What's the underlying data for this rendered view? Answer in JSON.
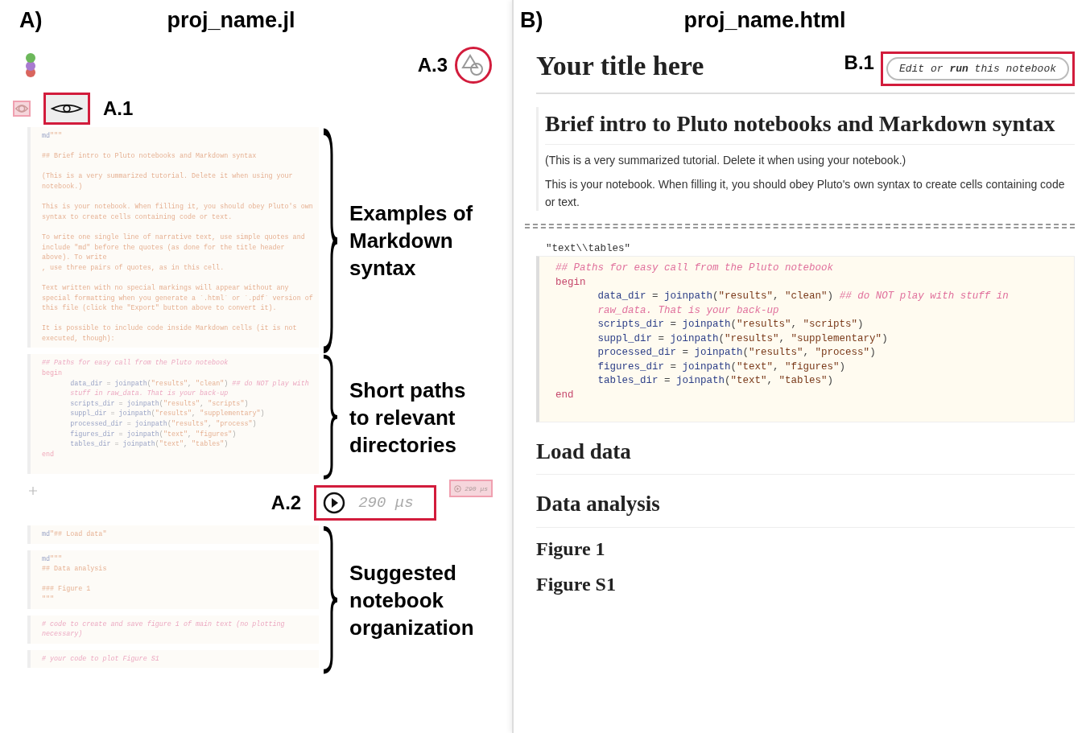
{
  "panel_a": {
    "letter": "A)",
    "file_title": "proj_name.jl",
    "a3_label": "A.3",
    "a1_label": "A.1",
    "a2_label": "A.2",
    "a2_timing": "290 μs",
    "cell_timing": "290 μs",
    "groups": [
      {
        "annotation": "Examples of Markdown syntax",
        "cells": [
          {
            "lines": [
              {
                "kind": "code",
                "segments": [
                  {
                    "kind": "macro",
                    "text": "md"
                  },
                  {
                    "kind": "string",
                    "text": "\"\"\""
                  }
                ]
              },
              {
                "kind": "blank"
              },
              {
                "kind": "code",
                "segments": [
                  {
                    "kind": "string",
                    "text": "## Brief intro to Pluto notebooks and Markdown syntax"
                  }
                ]
              },
              {
                "kind": "blank"
              },
              {
                "kind": "code",
                "segments": [
                  {
                    "kind": "string",
                    "text": "(This is a very summarized tutorial. Delete it when using your notebook.)"
                  }
                ]
              },
              {
                "kind": "blank"
              },
              {
                "kind": "code",
                "segments": [
                  {
                    "kind": "string",
                    "text": "This is your notebook. When filling it, you should obey Pluto's own syntax to create cells containing code or text."
                  }
                ]
              },
              {
                "kind": "blank"
              },
              {
                "kind": "code",
                "segments": [
                  {
                    "kind": "string",
                    "text": "To write one single line of narrative text, use simple quotes and include \"md\" before the quotes (as done for the title header above). To write"
                  }
                ]
              },
              {
                "kind": "code",
                "segments": [
                  {
                    "kind": "string",
                    "text": ", use three pairs of quotes, as in this cell."
                  }
                ]
              },
              {
                "kind": "blank"
              },
              {
                "kind": "code",
                "segments": [
                  {
                    "kind": "string",
                    "text": "Text written with no special markings will appear without any special formatting when you generate a `.html` or `.pdf` version of this file (click the \"Export\" button above to convert it)."
                  }
                ]
              },
              {
                "kind": "blank"
              },
              {
                "kind": "code",
                "segments": [
                  {
                    "kind": "string",
                    "text": "It is possible to include code inside Markdown cells (it is not executed, though):"
                  }
                ]
              }
            ]
          }
        ]
      },
      {
        "annotation": "Short paths to relevant directories",
        "cells": [
          {
            "lines": [
              {
                "kind": "code",
                "segments": [
                  {
                    "kind": "comment",
                    "text": "## Paths for easy call from the Pluto notebook"
                  }
                ]
              },
              {
                "kind": "code",
                "segments": [
                  {
                    "kind": "keyword",
                    "text": "begin"
                  }
                ]
              },
              {
                "kind": "code",
                "indent": true,
                "segments": [
                  {
                    "kind": "var",
                    "text": "data_dir"
                  },
                  {
                    "kind": "plain",
                    "text": " = "
                  },
                  {
                    "kind": "var",
                    "text": "joinpath"
                  },
                  {
                    "kind": "plain",
                    "text": "("
                  },
                  {
                    "kind": "string",
                    "text": "\"results\""
                  },
                  {
                    "kind": "plain",
                    "text": ", "
                  },
                  {
                    "kind": "string",
                    "text": "\"clean\""
                  },
                  {
                    "kind": "plain",
                    "text": ") "
                  },
                  {
                    "kind": "comment",
                    "text": "## do NOT play with stuff in raw_data. That is your back-up"
                  }
                ]
              },
              {
                "kind": "code",
                "indent": true,
                "segments": [
                  {
                    "kind": "var",
                    "text": "scripts_dir"
                  },
                  {
                    "kind": "plain",
                    "text": " = "
                  },
                  {
                    "kind": "var",
                    "text": "joinpath"
                  },
                  {
                    "kind": "plain",
                    "text": "("
                  },
                  {
                    "kind": "string",
                    "text": "\"results\""
                  },
                  {
                    "kind": "plain",
                    "text": ", "
                  },
                  {
                    "kind": "string",
                    "text": "\"scripts\""
                  },
                  {
                    "kind": "plain",
                    "text": ")"
                  }
                ]
              },
              {
                "kind": "code",
                "indent": true,
                "segments": [
                  {
                    "kind": "var",
                    "text": "suppl_dir"
                  },
                  {
                    "kind": "plain",
                    "text": " = "
                  },
                  {
                    "kind": "var",
                    "text": "joinpath"
                  },
                  {
                    "kind": "plain",
                    "text": "("
                  },
                  {
                    "kind": "string",
                    "text": "\"results\""
                  },
                  {
                    "kind": "plain",
                    "text": ", "
                  },
                  {
                    "kind": "string",
                    "text": "\"supplementary\""
                  },
                  {
                    "kind": "plain",
                    "text": ")"
                  }
                ]
              },
              {
                "kind": "code",
                "indent": true,
                "segments": [
                  {
                    "kind": "var",
                    "text": "processed_dir"
                  },
                  {
                    "kind": "plain",
                    "text": " = "
                  },
                  {
                    "kind": "var",
                    "text": "joinpath"
                  },
                  {
                    "kind": "plain",
                    "text": "("
                  },
                  {
                    "kind": "string",
                    "text": "\"results\""
                  },
                  {
                    "kind": "plain",
                    "text": ", "
                  },
                  {
                    "kind": "string",
                    "text": "\"process\""
                  },
                  {
                    "kind": "plain",
                    "text": ")"
                  }
                ]
              },
              {
                "kind": "code",
                "indent": true,
                "segments": [
                  {
                    "kind": "var",
                    "text": "figures_dir"
                  },
                  {
                    "kind": "plain",
                    "text": " = "
                  },
                  {
                    "kind": "var",
                    "text": "joinpath"
                  },
                  {
                    "kind": "plain",
                    "text": "("
                  },
                  {
                    "kind": "string",
                    "text": "\"text\""
                  },
                  {
                    "kind": "plain",
                    "text": ", "
                  },
                  {
                    "kind": "string",
                    "text": "\"figures\""
                  },
                  {
                    "kind": "plain",
                    "text": ")"
                  }
                ]
              },
              {
                "kind": "code",
                "indent": true,
                "segments": [
                  {
                    "kind": "var",
                    "text": "tables_dir"
                  },
                  {
                    "kind": "plain",
                    "text": " = "
                  },
                  {
                    "kind": "var",
                    "text": "joinpath"
                  },
                  {
                    "kind": "plain",
                    "text": "("
                  },
                  {
                    "kind": "string",
                    "text": "\"text\""
                  },
                  {
                    "kind": "plain",
                    "text": ", "
                  },
                  {
                    "kind": "string",
                    "text": "\"tables\""
                  },
                  {
                    "kind": "plain",
                    "text": ")"
                  }
                ]
              },
              {
                "kind": "code",
                "segments": [
                  {
                    "kind": "keyword",
                    "text": "end"
                  }
                ]
              },
              {
                "kind": "blank"
              }
            ]
          }
        ]
      },
      {
        "annotation": "Suggested notebook organization",
        "cells": [
          {
            "lines": [
              {
                "kind": "code",
                "segments": [
                  {
                    "kind": "macro",
                    "text": "md"
                  },
                  {
                    "kind": "string",
                    "text": "\"## Load data\""
                  }
                ]
              }
            ]
          },
          {
            "lines": [
              {
                "kind": "code",
                "segments": [
                  {
                    "kind": "macro",
                    "text": "md"
                  },
                  {
                    "kind": "string",
                    "text": "\"\"\""
                  }
                ]
              },
              {
                "kind": "code",
                "segments": [
                  {
                    "kind": "string",
                    "text": "## Data analysis"
                  }
                ]
              },
              {
                "kind": "blank"
              },
              {
                "kind": "code",
                "segments": [
                  {
                    "kind": "string",
                    "text": "### Figure 1"
                  }
                ]
              },
              {
                "kind": "code",
                "segments": [
                  {
                    "kind": "string",
                    "text": "\"\"\""
                  }
                ]
              }
            ]
          },
          {
            "lines": [
              {
                "kind": "code",
                "segments": [
                  {
                    "kind": "comment",
                    "text": "# code to create and save figure 1 of main text (no plotting necessary)"
                  }
                ]
              }
            ]
          },
          {
            "lines": [
              {
                "kind": "code",
                "segments": [
                  {
                    "kind": "comment",
                    "text": "# your code to plot Figure S1"
                  }
                ]
              }
            ]
          }
        ]
      }
    ]
  },
  "panel_b": {
    "letter": "B)",
    "file_title": "proj_name.html",
    "b1_label": "B.1",
    "edit_button": "*Edit* or **run** this notebook",
    "title": "Your title here",
    "intro_heading": "Brief intro to Pluto notebooks and Markdown syntax",
    "paragraphs": [
      "(This is a very summarized tutorial. Delete it when using your notebook.)",
      "This is your notebook. When filling it, you should obey Pluto's own syntax to create cells containing code or text."
    ],
    "output": "\"text\\\\tables\"",
    "code_lines": [
      {
        "kind": "code",
        "segments": [
          {
            "kind": "comment",
            "text": "## Paths for easy call from the Pluto notebook"
          }
        ]
      },
      {
        "kind": "code",
        "segments": [
          {
            "kind": "keyword",
            "text": "begin"
          }
        ]
      },
      {
        "kind": "code",
        "indent": true,
        "segments": [
          {
            "kind": "var",
            "text": "data_dir"
          },
          {
            "kind": "plain",
            "text": " = "
          },
          {
            "kind": "var",
            "text": "joinpath"
          },
          {
            "kind": "plain",
            "text": "("
          },
          {
            "kind": "string",
            "text": "\"results\""
          },
          {
            "kind": "plain",
            "text": ", "
          },
          {
            "kind": "string",
            "text": "\"clean\""
          },
          {
            "kind": "plain",
            "text": ") "
          },
          {
            "kind": "comment",
            "text": "## do NOT play with stuff in raw_data. That is your back-up"
          }
        ]
      },
      {
        "kind": "code",
        "indent": true,
        "segments": [
          {
            "kind": "var",
            "text": "scripts_dir"
          },
          {
            "kind": "plain",
            "text": " = "
          },
          {
            "kind": "var",
            "text": "joinpath"
          },
          {
            "kind": "plain",
            "text": "("
          },
          {
            "kind": "string",
            "text": "\"results\""
          },
          {
            "kind": "plain",
            "text": ", "
          },
          {
            "kind": "string",
            "text": "\"scripts\""
          },
          {
            "kind": "plain",
            "text": ")"
          }
        ]
      },
      {
        "kind": "code",
        "indent": true,
        "segments": [
          {
            "kind": "var",
            "text": "suppl_dir"
          },
          {
            "kind": "plain",
            "text": " = "
          },
          {
            "kind": "var",
            "text": "joinpath"
          },
          {
            "kind": "plain",
            "text": "("
          },
          {
            "kind": "string",
            "text": "\"results\""
          },
          {
            "kind": "plain",
            "text": ", "
          },
          {
            "kind": "string",
            "text": "\"supplementary\""
          },
          {
            "kind": "plain",
            "text": ")"
          }
        ]
      },
      {
        "kind": "code",
        "indent": true,
        "segments": [
          {
            "kind": "var",
            "text": "processed_dir"
          },
          {
            "kind": "plain",
            "text": " = "
          },
          {
            "kind": "var",
            "text": "joinpath"
          },
          {
            "kind": "plain",
            "text": "("
          },
          {
            "kind": "string",
            "text": "\"results\""
          },
          {
            "kind": "plain",
            "text": ", "
          },
          {
            "kind": "string",
            "text": "\"process\""
          },
          {
            "kind": "plain",
            "text": ")"
          }
        ]
      },
      {
        "kind": "code",
        "indent": true,
        "segments": [
          {
            "kind": "var",
            "text": "figures_dir"
          },
          {
            "kind": "plain",
            "text": " = "
          },
          {
            "kind": "var",
            "text": "joinpath"
          },
          {
            "kind": "plain",
            "text": "("
          },
          {
            "kind": "string",
            "text": "\"text\""
          },
          {
            "kind": "plain",
            "text": ", "
          },
          {
            "kind": "string",
            "text": "\"figures\""
          },
          {
            "kind": "plain",
            "text": ")"
          }
        ]
      },
      {
        "kind": "code",
        "indent": true,
        "segments": [
          {
            "kind": "var",
            "text": "tables_dir"
          },
          {
            "kind": "plain",
            "text": " = "
          },
          {
            "kind": "var",
            "text": "joinpath"
          },
          {
            "kind": "plain",
            "text": "("
          },
          {
            "kind": "string",
            "text": "\"text\""
          },
          {
            "kind": "plain",
            "text": ", "
          },
          {
            "kind": "string",
            "text": "\"tables\""
          },
          {
            "kind": "plain",
            "text": ")"
          }
        ]
      },
      {
        "kind": "code",
        "segments": [
          {
            "kind": "keyword",
            "text": "end"
          }
        ]
      },
      {
        "kind": "blank"
      }
    ],
    "sections": [
      {
        "kind": "h2",
        "text": "Load data"
      },
      {
        "kind": "h2",
        "text": "Data analysis"
      },
      {
        "kind": "h3",
        "text": "Figure 1"
      },
      {
        "kind": "h3",
        "text": "Figure S1"
      }
    ]
  }
}
